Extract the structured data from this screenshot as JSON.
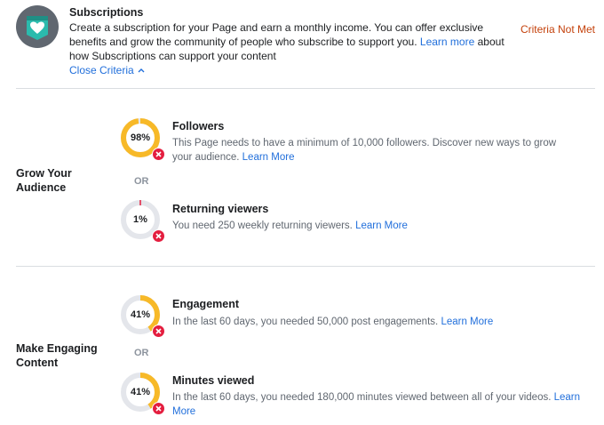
{
  "header": {
    "title": "Subscriptions",
    "desc_part1": "Create a subscription for your Page and earn a monthly income. You can offer exclusive benefits and grow the community of people who subscribe to support you.",
    "learn_more_label": "Learn more",
    "desc_part2": "about how Subscriptions can support your content",
    "close_criteria_label": "Close Criteria",
    "status": "Criteria Not Met",
    "icon": "subscriptions-heart-badge-icon"
  },
  "colors": {
    "progress": "#f7b928",
    "track": "#e4e6eb",
    "error": "#e41e3f",
    "link": "#216fdb",
    "status": "#c4410b"
  },
  "groups": [
    {
      "label": "Grow Your Audience",
      "or_label": "OR",
      "criteria": [
        {
          "name": "Followers",
          "percent": 98,
          "percent_label": "98%",
          "desc": "This Page needs to have a minimum of 10,000 followers. Discover new ways to grow your audience.",
          "link_label": "Learn More"
        },
        {
          "name": "Returning viewers",
          "percent": 1,
          "percent_label": "1%",
          "desc": "You need 250 weekly returning viewers.",
          "link_label": "Learn More"
        }
      ]
    },
    {
      "label": "Make Engaging Content",
      "or_label": "OR",
      "criteria": [
        {
          "name": "Engagement",
          "percent": 41,
          "percent_label": "41%",
          "desc": "In the last 60 days, you needed 50,000 post engagements.",
          "link_label": "Learn More"
        },
        {
          "name": "Minutes viewed",
          "percent": 41,
          "percent_label": "41%",
          "desc": "In the last 60 days, you needed 180,000 minutes viewed between all of your videos.",
          "link_label": "Learn More"
        }
      ]
    }
  ]
}
